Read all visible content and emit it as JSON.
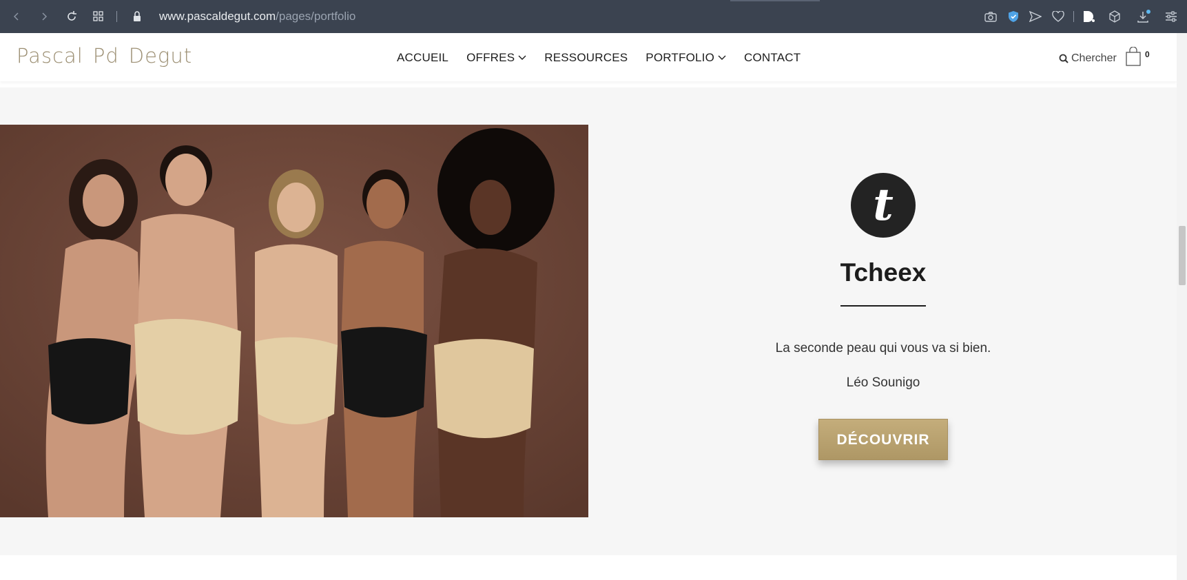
{
  "browser": {
    "url_domain": "www.pascaldegut.com",
    "url_path": "/pages/portfolio",
    "icons": [
      "back-icon",
      "forward-icon",
      "reload-icon",
      "grid-icon",
      "lock-icon",
      "camera-icon",
      "shield-icon",
      "send-icon",
      "heart-icon",
      "d-extension-icon",
      "cube-icon",
      "download-icon",
      "settings-icon"
    ]
  },
  "header": {
    "logo_left": "Pascal",
    "logo_mono": "Pd",
    "logo_right": "Degut",
    "nav": [
      {
        "label": "ACCUEIL",
        "dropdown": false
      },
      {
        "label": "OFFRES",
        "dropdown": true
      },
      {
        "label": "RESSOURCES",
        "dropdown": false
      },
      {
        "label": "PORTFOLIO",
        "dropdown": true
      },
      {
        "label": "CONTACT",
        "dropdown": false
      }
    ],
    "search_label": "Chercher",
    "cart_count": "0"
  },
  "portfolio": {
    "brand_logo_letter": "t",
    "brand_name": "Tcheex",
    "tagline": "La seconde peau qui vous va si bien.",
    "author": "Léo Sounigo",
    "cta_label": "DÉCOUVRIR"
  },
  "colors": {
    "browser_bg": "#3b4350",
    "accent_gold": "#b6a06f",
    "section_bg": "#f6f6f6"
  }
}
